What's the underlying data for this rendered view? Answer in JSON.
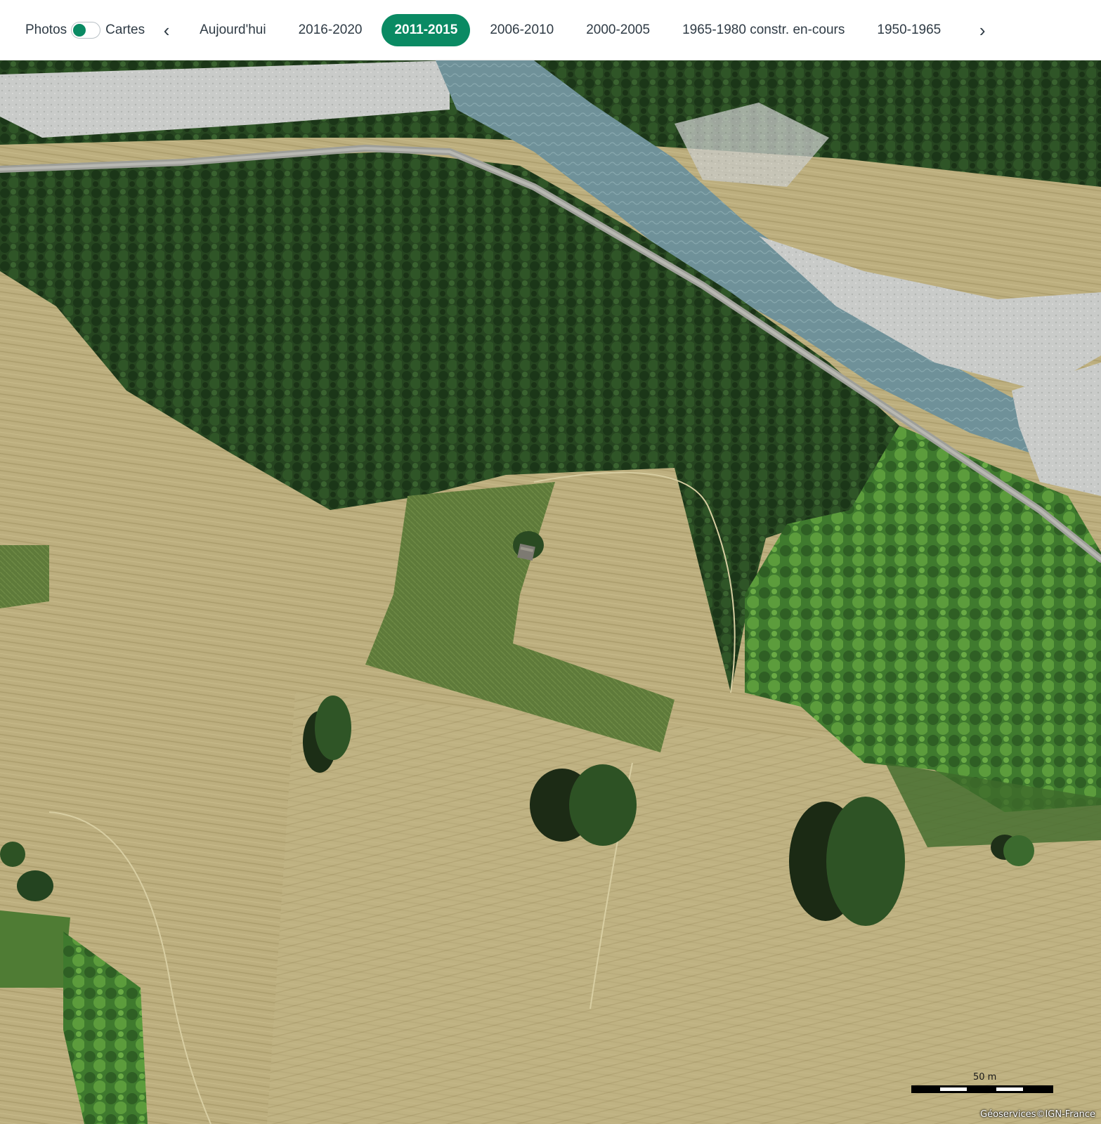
{
  "toggle": {
    "left_label": "Photos",
    "right_label": "Cartes",
    "state": "photos"
  },
  "nav": {
    "prev_icon": "chevron-left-icon",
    "next_icon": "chevron-right-icon",
    "prev_glyph": "‹",
    "next_glyph": "›"
  },
  "periods": [
    {
      "label": "Aujourd'hui",
      "active": false
    },
    {
      "label": "2016-2020",
      "active": false
    },
    {
      "label": "2011-2015",
      "active": true
    },
    {
      "label": "2006-2010",
      "active": false
    },
    {
      "label": "2000-2005",
      "active": false
    },
    {
      "label": "1965-1980 constr. en-cours",
      "active": false
    },
    {
      "label": "1950-1965",
      "active": false
    }
  ],
  "map": {
    "scale_label": "50 m",
    "attribution": "Géoservices©IGN-France"
  },
  "colors": {
    "accent": "#0a8a63",
    "text": "#2f3b45",
    "forest": "#2a4a23",
    "field": "#b8ab7b",
    "river": "#7a9aa0"
  }
}
